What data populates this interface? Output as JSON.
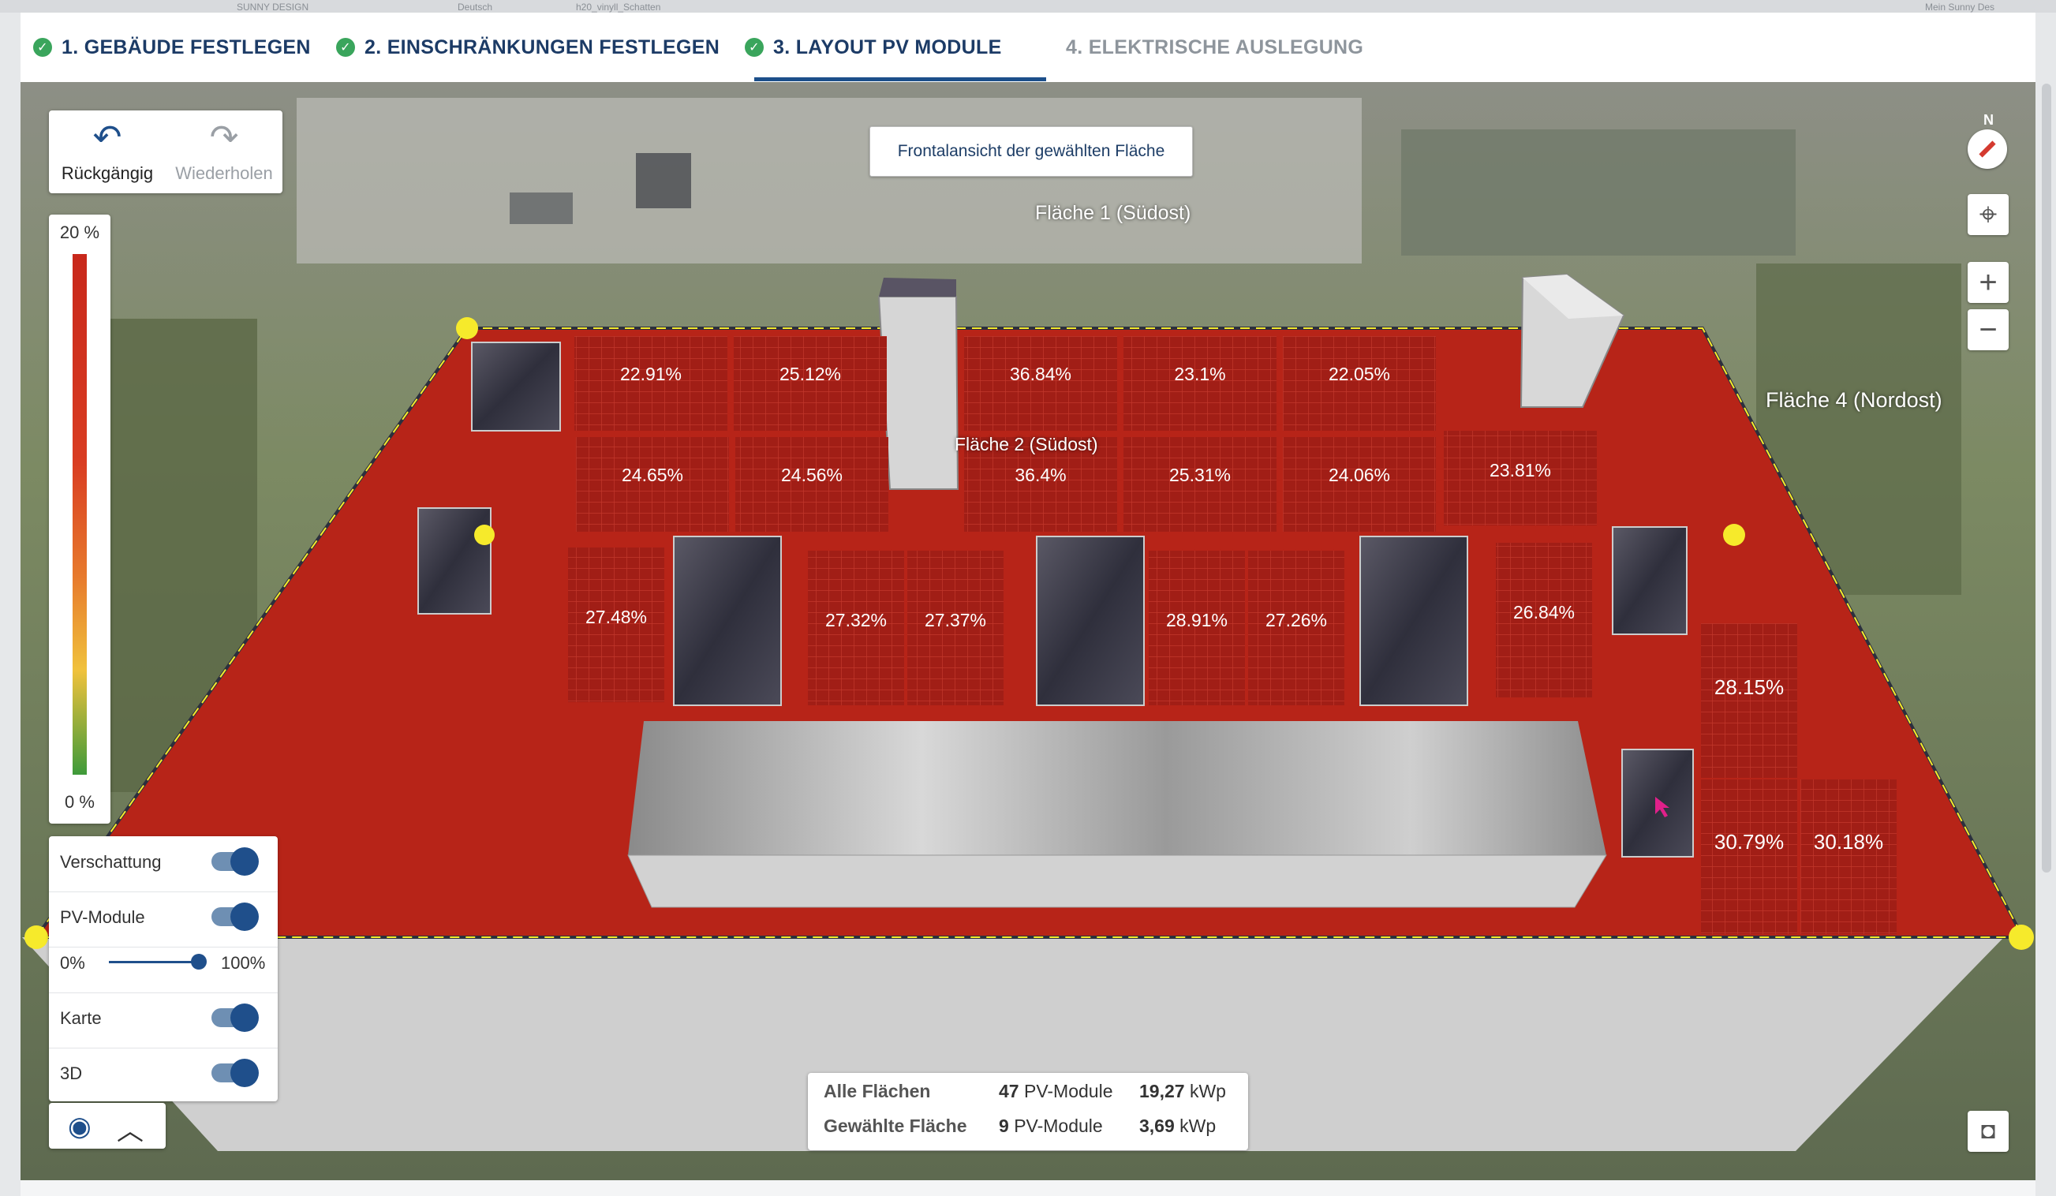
{
  "header": {
    "faded_left": "SUNNY DESIGN",
    "faded_mid1": "Deutsch",
    "faded_mid2": "h20_vinyll_Schatten",
    "faded_right": "Mein Sunny Des"
  },
  "tabs": [
    {
      "label": "1. GEBÄUDE FESTLEGEN",
      "done": true
    },
    {
      "label": "2. EINSCHRÄNKUNGEN FESTLEGEN",
      "done": true
    },
    {
      "label": "3. LAYOUT PV MODULE",
      "done": true,
      "active": true
    },
    {
      "label": "4. ELEKTRISCHE AUSLEGUNG",
      "done": false
    }
  ],
  "history": {
    "undo_label": "Rückgängig",
    "redo_label": "Wiederholen"
  },
  "legend": {
    "max_label": "20 %",
    "min_label": "0 %"
  },
  "tooltip": "Frontalansicht der gewählten Fläche",
  "areas": {
    "a1": "Fläche 1 (Südost)",
    "a2": "Fläche 2 (Südost)",
    "a4": "Fläche 4 (Nordost)"
  },
  "modules": {
    "m01": "22.91%",
    "m02": "25.12%",
    "m03": "36.84%",
    "m04": "23.1%",
    "m05": "22.05%",
    "m06": "24.65%",
    "m07": "24.56%",
    "m08": "36.4%",
    "m09": "25.31%",
    "m10": "24.06%",
    "m11": "23.81%",
    "m12": "27.48%",
    "m13": "27.32%",
    "m14": "27.37%",
    "m15": "28.91%",
    "m16": "27.26%",
    "m17": "26.84%",
    "m18": "28.15%",
    "m19": "30.79%",
    "m20": "30.18%"
  },
  "layers": {
    "shading": "Verschattung",
    "pv_modules": "PV-Module",
    "opacity_min": "0%",
    "opacity_max": "100%",
    "opacity_value": 1.0,
    "map": "Karte",
    "three_d": "3D"
  },
  "toggles": {
    "shading": true,
    "pv_modules": true,
    "map": true,
    "three_d": true
  },
  "compass": "N",
  "summary": {
    "all_label": "Alle Flächen",
    "all_modules": "47",
    "all_modules_unit": "PV-Module",
    "all_power": "19,27",
    "all_power_unit": "kWp",
    "sel_label": "Gewählte Fläche",
    "sel_modules": "9",
    "sel_modules_unit": "PV-Module",
    "sel_power": "3,69",
    "sel_power_unit": "kWp"
  },
  "colors": {
    "roof": "#b72418",
    "module_fill": "#a11e16",
    "module_grid": "#c2372b",
    "obstacle_dark": "#3b3b4c",
    "accent": "#1f4f8b",
    "handle": "#f6ea2b"
  }
}
